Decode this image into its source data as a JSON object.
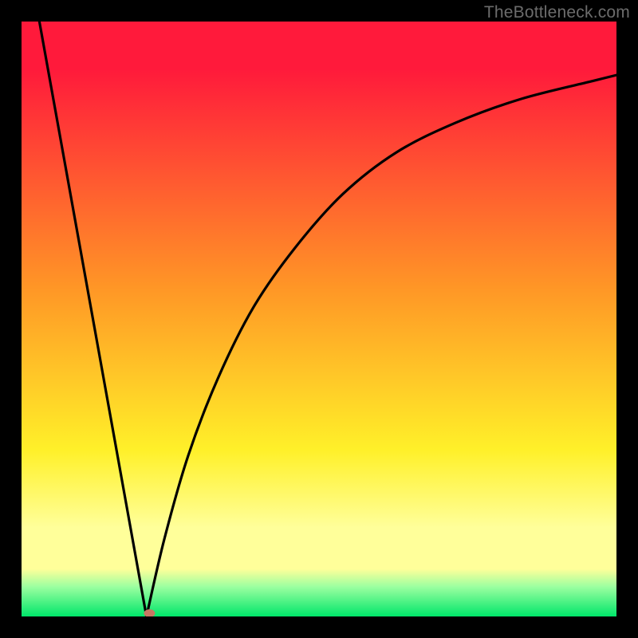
{
  "watermark": "TheBottleneck.com",
  "colors": {
    "red": "#ff1a3b",
    "orange": "#ff9726",
    "yellow": "#fff029",
    "paleyellow": "#ffff9a",
    "palegreen": "#9cffa0",
    "green": "#00e66a",
    "curve": "#000000",
    "marker": "#c77763"
  },
  "chart_data": {
    "type": "line",
    "title": "",
    "xlabel": "",
    "ylabel": "",
    "xlim": [
      0,
      1
    ],
    "ylim": [
      0,
      1
    ],
    "series": [
      {
        "name": "left-branch",
        "x": [
          0.03,
          0.21
        ],
        "y": [
          1.0,
          0.0
        ]
      },
      {
        "name": "right-branch",
        "x": [
          0.21,
          0.24,
          0.28,
          0.33,
          0.39,
          0.46,
          0.54,
          0.63,
          0.73,
          0.84,
          0.96,
          1.0
        ],
        "y": [
          0.0,
          0.13,
          0.27,
          0.4,
          0.52,
          0.62,
          0.71,
          0.78,
          0.83,
          0.87,
          0.9,
          0.91
        ]
      }
    ],
    "marker": {
      "x": 0.215,
      "y": 0.0
    },
    "annotations": []
  }
}
